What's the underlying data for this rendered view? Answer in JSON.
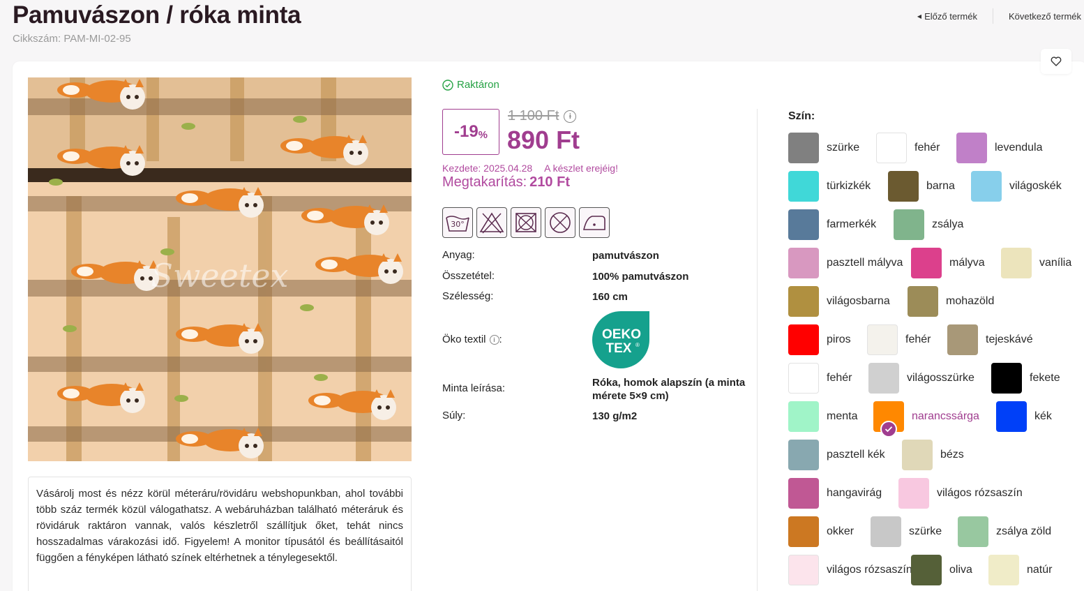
{
  "product": {
    "title": "Pamuvászon / róka minta",
    "sku": "Cikkszám: PAM-MI-02-95"
  },
  "nav": {
    "prev": "Előző termék",
    "next": "Következő termék"
  },
  "watermark": "Sweetex",
  "stock": "Raktáron",
  "price": {
    "discount": "-19",
    "discount_unit": "%",
    "old": "1 100 Ft",
    "new": "890 Ft",
    "since": "Kezdete: 2025.04.28",
    "until": "A készlet erejéig!",
    "savings_label": "Megtakarítás:",
    "savings_value": "210 Ft"
  },
  "care": {
    "wash_temp": "30°",
    "icons": [
      "wash-30-icon",
      "no-bleach-icon",
      "no-tumble-dry-icon",
      "no-dry-clean-icon",
      "iron-low-icon"
    ]
  },
  "specs": [
    {
      "label": "Anyag:",
      "value": "pamutvászon"
    },
    {
      "label": "Összetétel:",
      "value": "100% pamutvászon"
    },
    {
      "label": "Szélesség:",
      "value": "160 cm"
    },
    {
      "label": "Öko textil",
      "value": "OEKO TEX®"
    },
    {
      "label": "Minta leírása:",
      "value": "Róka, homok alapszín (a minta mérete 5×9 cm)"
    },
    {
      "label": "Súly:",
      "value": "130 g/m2"
    }
  ],
  "oeko": {
    "line1": "OEKO",
    "line2": "TEX",
    "mark": "®",
    "color": "#15a18d"
  },
  "description": "Vásárolj most és nézz körül méteráru/rövidáru webshopunkban, ahol további több száz termék közül válogathatsz. A webáruházban található méteráruk és rövidáruk raktáron vannak, valós készletről szállítjuk őket, tehát nincs hosszadalmas várakozási idő. Figyelem! A monitor típusától és beállításaitól függően a fényképen látható színek eltérhetnek a ténylegesektől.",
  "colors_title": "Szín:",
  "accent": "#a03d8f",
  "colors": [
    [
      {
        "name": "szürke",
        "hex": "#808080"
      },
      {
        "name": "fehér",
        "hex": "#ffffff"
      },
      {
        "name": "levendula",
        "hex": "#c080c8"
      }
    ],
    [
      {
        "name": "türkizkék",
        "hex": "#40d8d8"
      },
      {
        "name": "barna",
        "hex": "#6b5a30"
      },
      {
        "name": "világoskék",
        "hex": "#87cfeb"
      }
    ],
    [
      {
        "name": "farmerkék",
        "hex": "#587a9a"
      },
      {
        "name": "zsálya",
        "hex": "#80b48c"
      }
    ],
    [
      {
        "name": "pasztell mályva",
        "hex": "#d898c0"
      },
      {
        "name": "mályva",
        "hex": "#dc408c"
      },
      {
        "name": "vanília",
        "hex": "#ece4bc"
      }
    ],
    [
      {
        "name": "világosbarna",
        "hex": "#b09040"
      },
      {
        "name": "mohazöld",
        "hex": "#9c8c58"
      }
    ],
    [
      {
        "name": "piros",
        "hex": "#ff0000"
      },
      {
        "name": "fehér",
        "hex": "#f4f2ec"
      },
      {
        "name": "tejeskávé",
        "hex": "#a89878"
      }
    ],
    [
      {
        "name": "fehér",
        "hex": "#ffffff"
      },
      {
        "name": "világosszürke",
        "hex": "#d0d0d0"
      },
      {
        "name": "fekete",
        "hex": "#000000"
      }
    ],
    [
      {
        "name": "menta",
        "hex": "#a0f4c8"
      },
      {
        "name": "narancssárga",
        "hex": "#ff8800",
        "selected": true
      },
      {
        "name": "kék",
        "hex": "#0040f8"
      }
    ],
    [
      {
        "name": "pasztell kék",
        "hex": "#88a8b0"
      },
      {
        "name": "bézs",
        "hex": "#e0d8b8"
      }
    ],
    [
      {
        "name": "hangavirág",
        "hex": "#c05894"
      },
      {
        "name": "világos rózsaszín",
        "hex": "#f8c8e0"
      }
    ],
    [
      {
        "name": "okker",
        "hex": "#cc7822"
      },
      {
        "name": "szürke",
        "hex": "#c8c8c8"
      },
      {
        "name": "zsálya zöld",
        "hex": "#98c8a0"
      }
    ],
    [
      {
        "name": "világos rózsaszín",
        "hex": "#fce4ec"
      },
      {
        "name": "oliva",
        "hex": "#556038"
      },
      {
        "name": "natúr",
        "hex": "#f0ecc8"
      }
    ]
  ]
}
